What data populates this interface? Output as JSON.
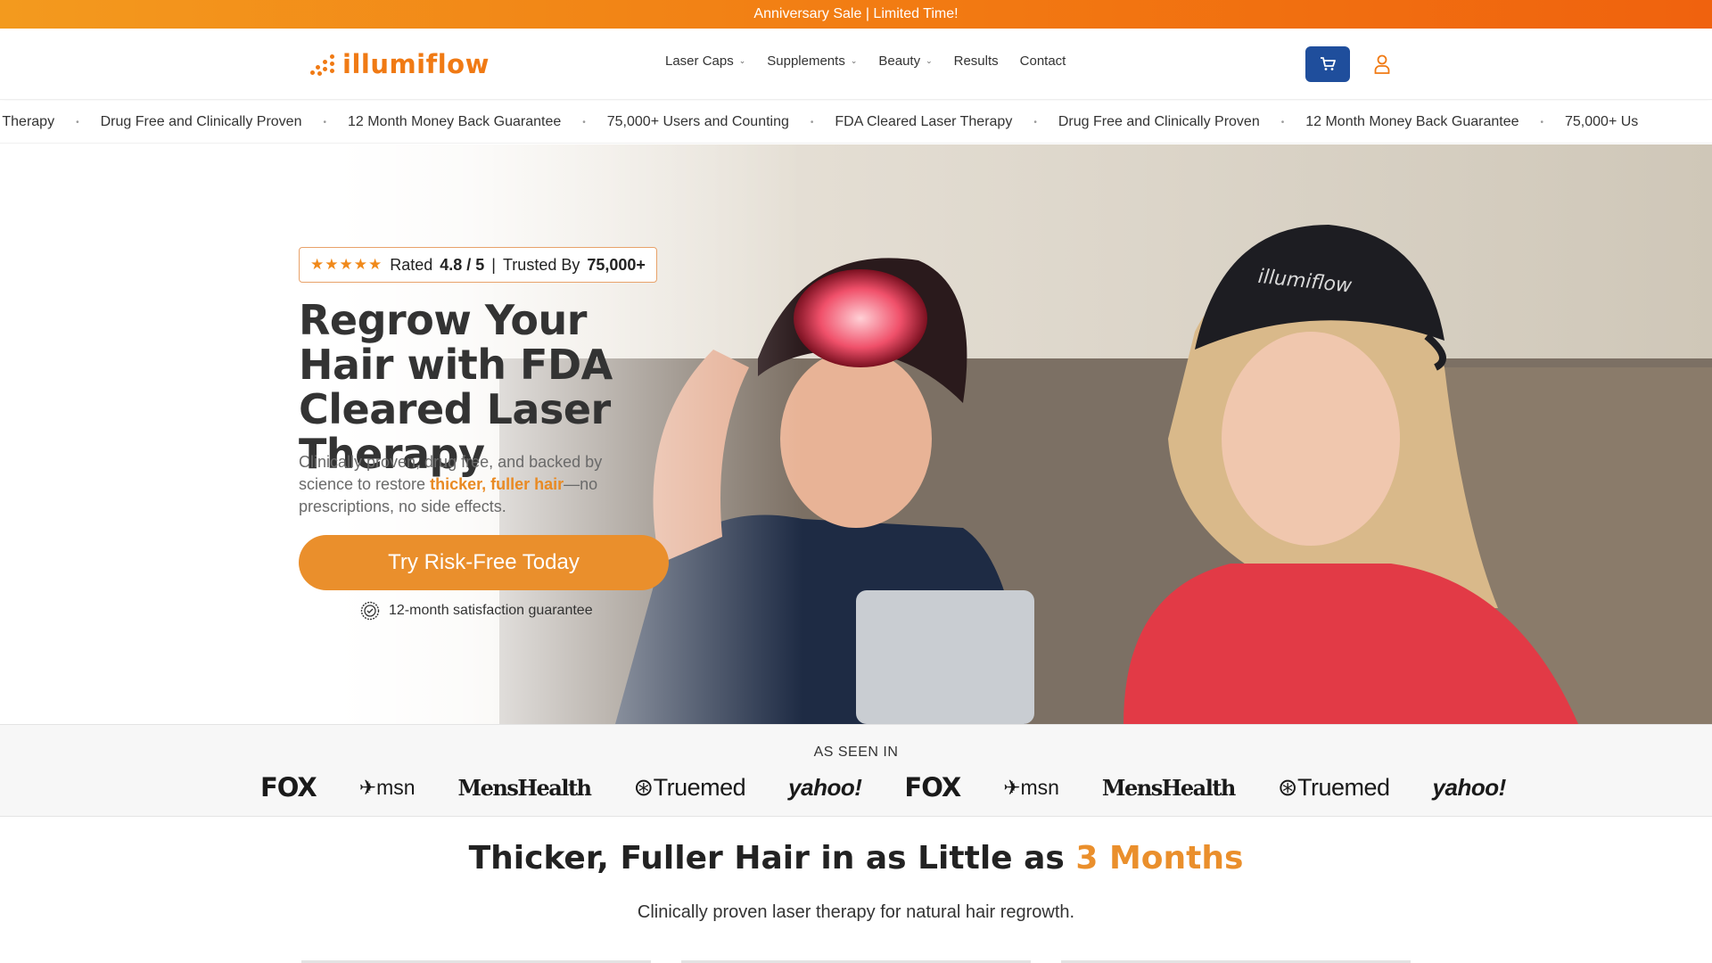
{
  "announcement": {
    "text": "Anniversary Sale | Limited Time!"
  },
  "header": {
    "logo_text": "illumiflow",
    "nav": [
      {
        "label": "Laser Caps",
        "has_dropdown": true
      },
      {
        "label": "Supplements",
        "has_dropdown": true
      },
      {
        "label": "Beauty",
        "has_dropdown": true
      },
      {
        "label": "Results",
        "has_dropdown": false
      },
      {
        "label": "Contact",
        "has_dropdown": false
      }
    ],
    "cart_icon": "cart-icon",
    "account_icon": "user-icon",
    "accent_color": "#f07a14",
    "cart_button_color": "#1f4e9c"
  },
  "ticker": {
    "items": [
      "er Therapy",
      "Drug Free and Clinically Proven",
      "12 Month Money Back Guarantee",
      "75,000+ Users and Counting",
      "FDA Cleared Laser Therapy",
      "Drug Free and Clinically Proven",
      "12 Month Money Back Guarantee",
      "75,000+ Us"
    ],
    "separator": "•"
  },
  "hero": {
    "rating": {
      "stars": "★★★★★",
      "prefix": "Rated",
      "score": "4.8 / 5",
      "divider": "|",
      "trusted_prefix": "Trusted By",
      "trusted_count": "75,000+"
    },
    "title": "Regrow Your Hair with FDA Cleared Laser Therapy",
    "subtitle_before": "Clinically proven, drug free, and backed by science to restore ",
    "subtitle_accent": "thicker, fuller hair",
    "subtitle_after": "—no prescriptions, no side effects.",
    "cta_label": "Try Risk-Free Today",
    "guarantee_text": "12-month satisfaction guarantee",
    "cap_brand": "illumiflow",
    "cta_color": "#ea8f2c"
  },
  "as_seen_in": {
    "label": "AS SEEN IN",
    "logos": [
      "FOX",
      "msn",
      "MensHealth",
      "Truemed",
      "yahoo!",
      "FOX",
      "msn",
      "MensHealth",
      "Truemed",
      "yahoo!"
    ]
  },
  "section": {
    "title_before": "Thicker, Fuller Hair in as Little as ",
    "title_accent": "3 Months",
    "subtitle": "Clinically proven laser therapy for natural hair regrowth."
  }
}
